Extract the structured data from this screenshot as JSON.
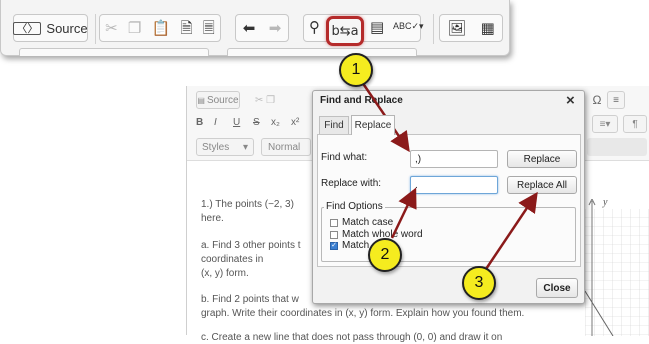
{
  "toolbar_top": {
    "source_label": "Source",
    "icons": [
      "source-icon",
      "cut-icon",
      "copy-icon",
      "paste-icon",
      "paste-text-icon",
      "paste-word-icon",
      "undo-icon",
      "redo-icon",
      "find-icon",
      "replace-icon",
      "select-all-icon",
      "spellcheck-icon",
      "image-icon",
      "table-icon"
    ],
    "spellcheck_label": "ABC"
  },
  "editor_bg": {
    "source_label": "Source",
    "bold": "B",
    "italic": "I",
    "underline": "U",
    "strike": "S",
    "subscript": "x₂",
    "superscript": "x²",
    "styles_label": "Styles",
    "format_label": "Normal",
    "omega": "Ω",
    "axis_label": "y",
    "doc": {
      "q1_line1": "1.)         The points (−2, 3)",
      "q1_line2": "here.",
      "qa_line1": "a.        Find 3 other points t",
      "qa_line2": "coordinates in",
      "qa_line3": "(x, y) form.",
      "qb_line1": "b.        Find 2 points that w",
      "qb_line2": "graph. Write their coordinates in (x, y) form. Explain how you found them.",
      "qc_line1": "c.        Create a new line that does not pass through (0, 0) and draw it on"
    }
  },
  "dialog": {
    "title": "Find and Replace",
    "close_x": "×",
    "tabs": [
      "Find",
      "Replace"
    ],
    "find_label": "Find what:",
    "find_value": ",)",
    "replace_label": "Replace with:",
    "replace_value": ".",
    "replace_button": "Replace",
    "replace_all_button": "Replace All",
    "options_legend": "Find Options",
    "options": [
      {
        "label": "Match case",
        "checked": false
      },
      {
        "label": "Match whole word",
        "checked": false
      },
      {
        "label": "Match cyclic",
        "checked": true
      }
    ],
    "close_button": "Close"
  },
  "callouts": [
    "1",
    "2",
    "3"
  ],
  "colors": {
    "callout_fill": "#f5ec1f",
    "arrow": "#8b1a1a",
    "highlight": "#c0392b"
  }
}
